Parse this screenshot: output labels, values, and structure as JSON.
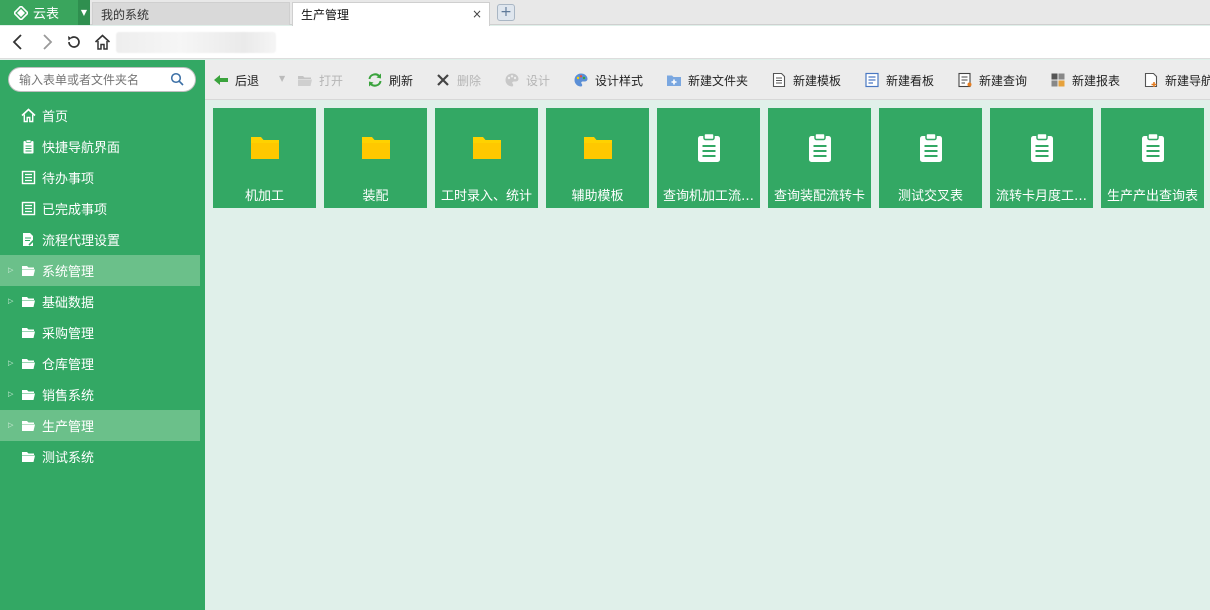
{
  "tabbar": {
    "brand_label": "云表",
    "tabs": [
      {
        "label": "我的系统"
      },
      {
        "label": "生产管理",
        "close": "×"
      }
    ],
    "add_tab": "+"
  },
  "sidebar": {
    "search_placeholder": "输入表单或者文件夹名",
    "items": [
      {
        "label": "首页",
        "icon": "home-icon"
      },
      {
        "label": "快捷导航界面",
        "icon": "clipboard-icon"
      },
      {
        "label": "待办事项",
        "icon": "list-icon"
      },
      {
        "label": "已完成事项",
        "icon": "list-icon"
      },
      {
        "label": "流程代理设置",
        "icon": "document-edit-icon"
      },
      {
        "label": "系统管理",
        "icon": "folder-open-icon",
        "expandable": true,
        "selected": true
      },
      {
        "label": "基础数据",
        "icon": "folder-open-icon",
        "expandable": true
      },
      {
        "label": "采购管理",
        "icon": "folder-open-icon"
      },
      {
        "label": "仓库管理",
        "icon": "folder-open-icon",
        "expandable": true
      },
      {
        "label": "销售系统",
        "icon": "folder-open-icon",
        "expandable": true
      },
      {
        "label": "生产管理",
        "icon": "folder-open-icon",
        "expandable": true,
        "selected": true
      },
      {
        "label": "测试系统",
        "icon": "folder-open-icon"
      }
    ]
  },
  "toolbar": {
    "items": [
      {
        "label": "后退",
        "icon": "back-arrow-icon"
      },
      {
        "label": "打开",
        "icon": "open-folder-icon",
        "disabled": true
      },
      {
        "label": "刷新",
        "icon": "refresh-icon"
      },
      {
        "label": "删除",
        "icon": "delete-icon",
        "disabled": true
      },
      {
        "label": "设计",
        "icon": "palette-icon",
        "disabled": true
      },
      {
        "label": "设计样式",
        "icon": "palette-icon"
      },
      {
        "label": "新建文件夹",
        "icon": "new-folder-icon"
      },
      {
        "label": "新建模板",
        "icon": "new-template-icon"
      },
      {
        "label": "新建看板",
        "icon": "new-board-icon"
      },
      {
        "label": "新建查询",
        "icon": "new-query-icon"
      },
      {
        "label": "新建报表",
        "icon": "new-report-icon"
      },
      {
        "label": "新建导航",
        "icon": "new-nav-icon"
      }
    ]
  },
  "tiles": [
    {
      "label": "机加工",
      "icon": "folder-icon"
    },
    {
      "label": "装配",
      "icon": "folder-icon"
    },
    {
      "label": "工时录入、统计",
      "icon": "folder-icon"
    },
    {
      "label": "辅助模板",
      "icon": "folder-icon"
    },
    {
      "label": "查询机加工流…",
      "icon": "clipboard-icon"
    },
    {
      "label": "查询装配流转卡",
      "icon": "clipboard-icon"
    },
    {
      "label": "测试交叉表",
      "icon": "clipboard-icon"
    },
    {
      "label": "流转卡月度工…",
      "icon": "clipboard-icon"
    },
    {
      "label": "生产产出查询表",
      "icon": "clipboard-icon"
    }
  ],
  "colors": {
    "brand_green": "#33a864",
    "sidebar_selected": "#6bc08a",
    "content_bg": "#e0f0ea",
    "folder_yellow": "#ffd200"
  }
}
